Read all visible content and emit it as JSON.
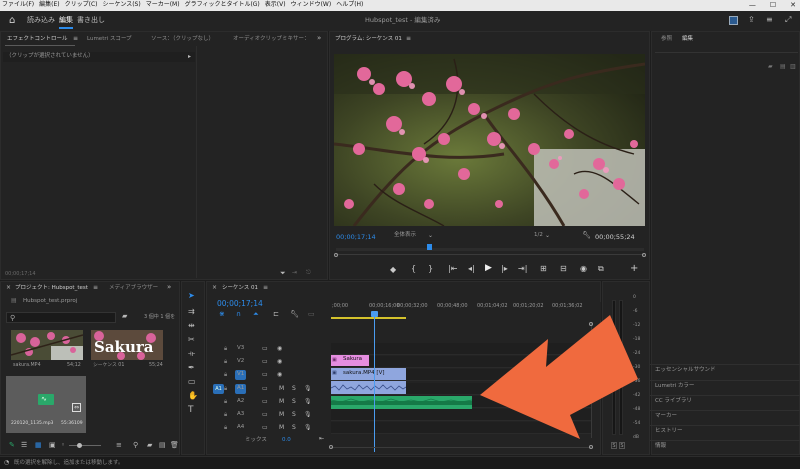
{
  "menu": {
    "items": [
      "ファイル(F)",
      "編集(E)",
      "クリップ(C)",
      "シーケンス(S)",
      "マーカー(M)",
      "グラフィックとタイトル(G)",
      "表示(V)",
      "ウィンドウ(W)",
      "ヘルプ(H)"
    ],
    "window_controls": [
      "—",
      "☐",
      "✕"
    ]
  },
  "header": {
    "workspaces": {
      "import": "読み込み",
      "edit": "編集",
      "export": "書き出し"
    },
    "title": "Hubspot_test - 編集済み"
  },
  "effects_panel": {
    "tabs": {
      "effect_controls": "エフェクトコントロール",
      "lumetri_scope": "Lumetri スコープ",
      "source": "ソース：（クリップなし）",
      "audio_mixer": "オーディオクリップミキサー："
    },
    "no_clip": "（クリップが選択されていません）",
    "timecode": "00;00;17;14"
  },
  "program_monitor": {
    "tab": "プログラム: シーケンス 01",
    "timecode_current": "00;00;17;14",
    "fit": "全体表示",
    "resolution": "1/2",
    "timecode_duration": "00;00;55;24"
  },
  "right_panel": {
    "tabs": {
      "library": "参照",
      "edit": "編集"
    },
    "items": [
      "エッセンシャルサウンド",
      "Lumetri カラー",
      "CC ライブラリ",
      "マーカー",
      "ヒストリー",
      "情報"
    ]
  },
  "project_panel": {
    "tabs": {
      "project": "プロジェクト: Hubspot_test",
      "media_browser": "メディアブラウザー"
    },
    "file": "Hubspot_test.prproj",
    "count": "3 個中 1 個を",
    "items": [
      {
        "name": "sakura.MP4",
        "duration": "54;12"
      },
      {
        "name": "シーケンス 01",
        "duration": "55;24",
        "thumb_text": "Sakura"
      },
      {
        "name": "220120_1135.mp3",
        "duration": "55:36109"
      }
    ]
  },
  "timeline": {
    "tab": "シーケンス 01",
    "timecode": "00;00;17;14",
    "ruler": [
      ";00;00",
      "00;00;16;00",
      "00;00;32;00",
      "00;00;48;00",
      "00;01;04;02",
      "00;01;20;02",
      "00;01;36;02"
    ],
    "video_tracks": [
      "V3",
      "V2",
      "V1"
    ],
    "audio_tracks": [
      "A1",
      "A2",
      "A3",
      "A4"
    ],
    "track_letters": {
      "mute": "M",
      "solo": "S"
    },
    "target": "A1",
    "mix_label": "ミックス",
    "mix_value": "0.0",
    "clips": {
      "title": "Sakura",
      "video": "sakura.MP4 [V]"
    }
  },
  "meter": {
    "scale": [
      "0",
      "-6",
      "-12",
      "-18",
      "-24",
      "-30",
      "-36",
      "-42",
      "-48",
      "-54",
      "dB"
    ],
    "solo_labels": [
      "S",
      "S"
    ]
  },
  "status_bar": {
    "text": "既の選択を解除し、追加または移動します。"
  },
  "colors": {
    "accent": "#2d8ceb",
    "title_clip": "#e58de0",
    "video_clip": "#8fa6de",
    "audio_clip": "#2aa86a",
    "arrow": "#f06a3e",
    "playhead": "#4a9cf0"
  }
}
